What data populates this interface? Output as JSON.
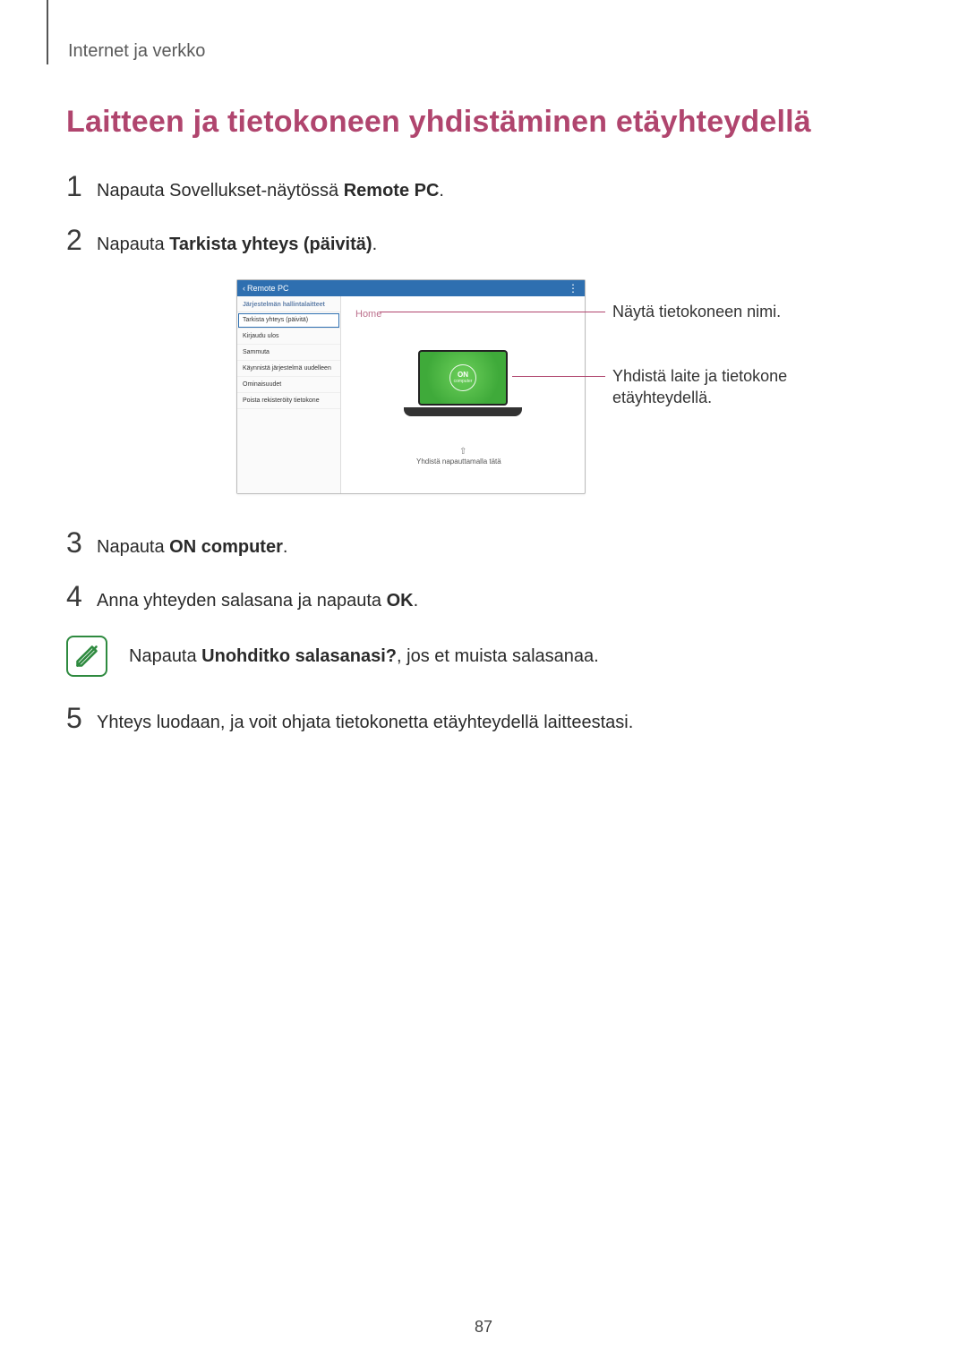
{
  "breadcrumb": "Internet ja verkko",
  "heading": "Laitteen ja tietokoneen yhdistäminen etäyhteydellä",
  "steps": {
    "s1_num": "1",
    "s1_pre": "Napauta Sovellukset-näytössä ",
    "s1_b": "Remote PC",
    "s1_post": ".",
    "s2_num": "2",
    "s2_pre": "Napauta ",
    "s2_b": "Tarkista yhteys (päivitä)",
    "s2_post": ".",
    "s3_num": "3",
    "s3_pre": "Napauta ",
    "s3_b": "ON computer",
    "s3_post": ".",
    "s4_num": "4",
    "s4_pre": "Anna yhteyden salasana ja napauta ",
    "s4_b": "OK",
    "s4_post": ".",
    "s5_num": "5",
    "s5_text": "Yhteys luodaan, ja voit ohjata tietokonetta etäyhteydellä laitteestasi."
  },
  "note": {
    "pre": "Napauta ",
    "b": "Unohditko salasanasi?",
    "post": ", jos et muista salasanaa."
  },
  "figure": {
    "titlebar_back": "Remote PC",
    "titlebar_dots": "⋮",
    "side_header": "Järjestelmän hallintalaitteet",
    "items": {
      "i0": "Tarkista yhteys (päivitä)",
      "i1": "Kirjaudu ulos",
      "i2": "Sammuta",
      "i3": "Käynnistä järjestelmä uudelleen",
      "i4": "Ominaisuudet",
      "i5": "Poista rekisteröity tietokone"
    },
    "home_label": "Home",
    "on_text": "ON",
    "on_sub": "computer",
    "arrow_up": "⇧",
    "tap_connect": "Yhdistä napauttamalla tätä",
    "callout1": "Näytä tietokoneen nimi.",
    "callout2": "Yhdistä laite ja tietokone etäyhteydellä."
  },
  "page_number": "87"
}
